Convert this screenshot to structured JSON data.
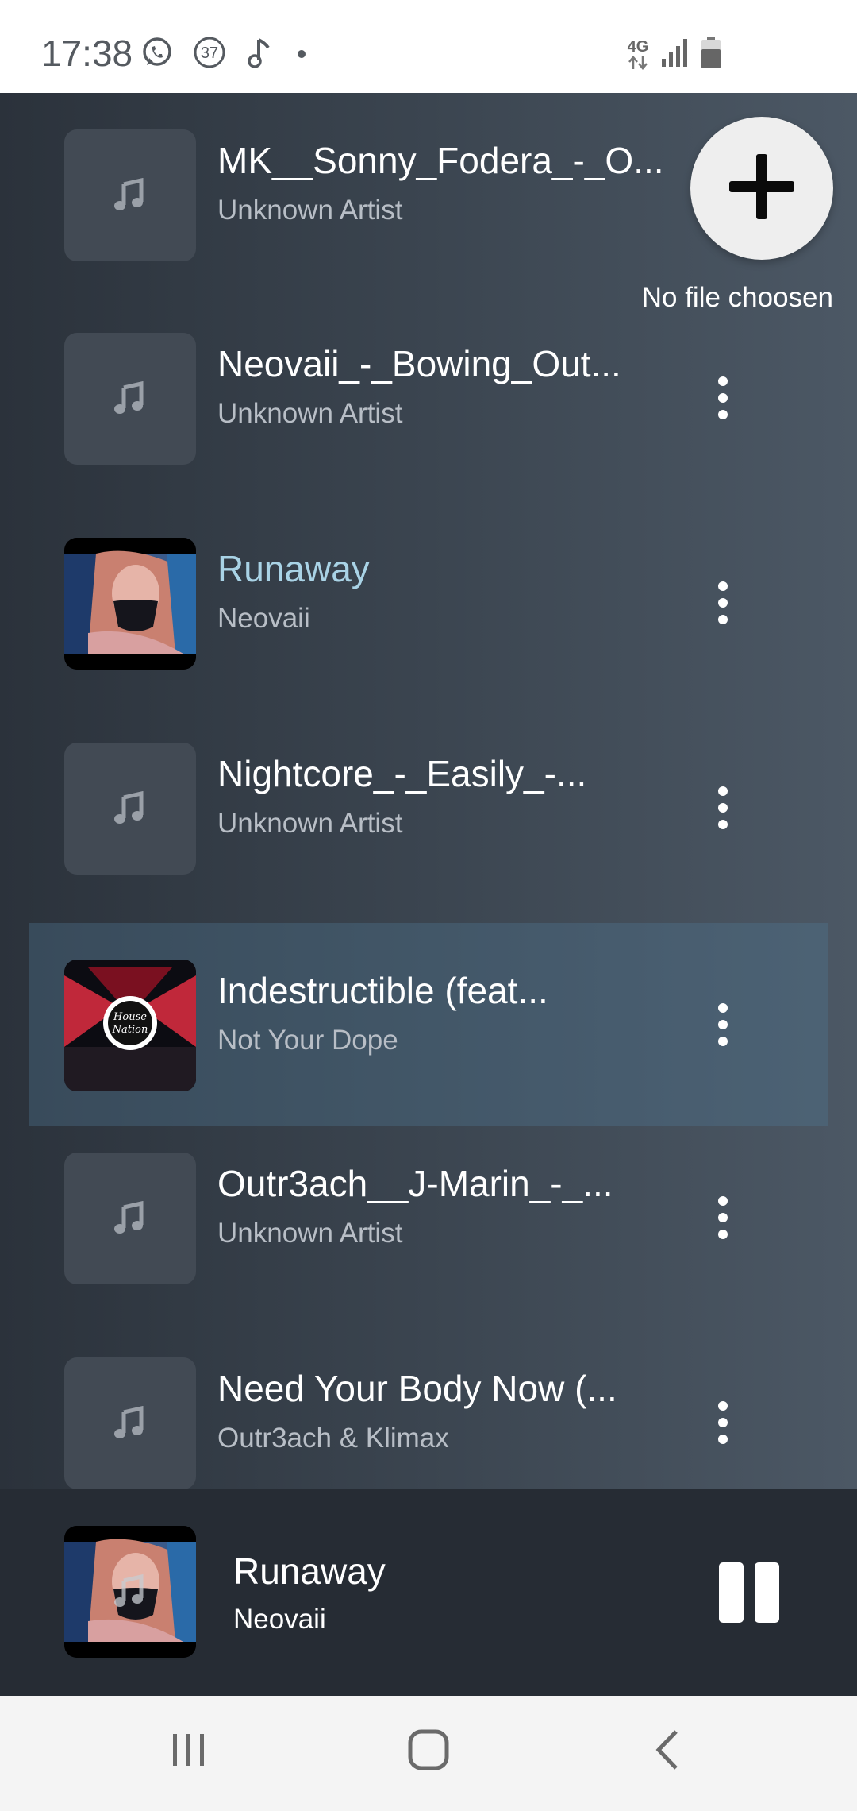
{
  "status_bar": {
    "time": "17:38",
    "notification_badge": "37",
    "network_type": "4G",
    "icons": [
      "whatsapp-icon",
      "badge-37-icon",
      "music-note-icon",
      "dot-icon",
      "network-arrows-icon",
      "signal-icon",
      "battery-icon"
    ]
  },
  "fab": {
    "icon": "plus-icon",
    "caption": "No file choosen"
  },
  "tracks": [
    {
      "title": "MK__Sonny_Fodera_-_O...",
      "artist": "Unknown Artist",
      "art": "music-note-icon"
    },
    {
      "title": "Neovaii_-_Bowing_Out...",
      "artist": "Unknown Artist",
      "art": "music-note-icon"
    },
    {
      "title": "Runaway",
      "artist": "Neovaii",
      "art": "album-art-girl"
    },
    {
      "title": "Nightcore_-_Easily_-...",
      "artist": "Unknown Artist",
      "art": "music-note-icon"
    },
    {
      "title": "Indestructible (feat...",
      "artist": "Not Your Dope",
      "art": "album-art-house-nation"
    },
    {
      "title": "Outr3ach__J-Marin_-_...",
      "artist": "Unknown Artist",
      "art": "music-note-icon"
    },
    {
      "title": "Need Your Body Now (...",
      "artist": "Outr3ach & Klimax",
      "art": "music-note-icon"
    }
  ],
  "now_playing": {
    "title": "Runaway",
    "artist": "Neovaii",
    "state_icon": "pause-icon"
  },
  "colors": {
    "playing_title": "#a9d3e6",
    "highlight_row": "#3f5668",
    "mini_player_bg": "#262c34"
  },
  "nav_bar": {
    "icons": [
      "recent-apps-icon",
      "home-icon",
      "back-icon"
    ]
  }
}
